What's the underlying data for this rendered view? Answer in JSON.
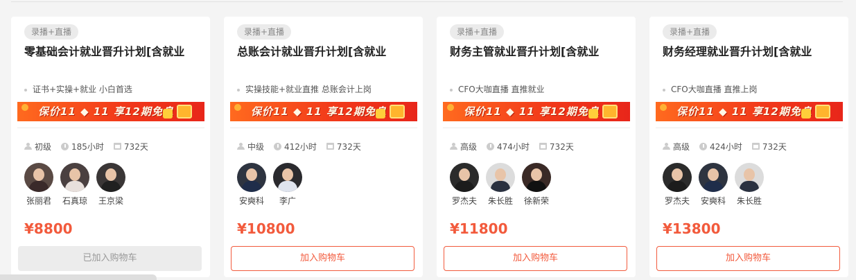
{
  "cards": [
    {
      "tag": "录播+直播",
      "title": "零基础会计就业晋升计划[含就业",
      "subtitle": "证书+实操+就业 小白首选",
      "banner": "保价11 ◆ 11  享12期免息",
      "level": "初级",
      "hours": "185小时",
      "days": "732天",
      "teachers": [
        "张丽君",
        "石真琼",
        "王京梁"
      ],
      "price": "¥8800",
      "button": "已加入购物车"
    },
    {
      "tag": "录播+直播",
      "title": "总账会计就业晋升计划[含就业",
      "subtitle": "实操技能+就业直推 总账会计上岗",
      "banner": "保价11 ◆ 11  享12期免息",
      "level": "中级",
      "hours": "412小时",
      "days": "732天",
      "teachers": [
        "安奭科",
        "李广"
      ],
      "price": "¥10800",
      "button": "加入购物车"
    },
    {
      "tag": "录播+直播",
      "title": "财务主管就业晋升计划[含就业",
      "subtitle": "CFO大咖直播 直推就业",
      "banner": "保价11 ◆ 11  享12期免息",
      "level": "高级",
      "hours": "474小时",
      "days": "732天",
      "teachers": [
        "罗杰夫",
        "朱长胜",
        "徐新荣"
      ],
      "price": "¥11800",
      "button": "加入购物车"
    },
    {
      "tag": "录播+直播",
      "title": "财务经理就业晋升计划[含就业",
      "subtitle": "CFO大咖直播 直推上岗",
      "banner": "保价11 ◆ 11  享12期免息",
      "level": "高级",
      "hours": "424小时",
      "days": "732天",
      "teachers": [
        "罗杰夫",
        "安奭科",
        "朱长胜"
      ],
      "price": "¥13800",
      "button": "加入购物车"
    }
  ],
  "colors": {
    "accent": "#f25a3c",
    "banner": "#f23a1a"
  }
}
